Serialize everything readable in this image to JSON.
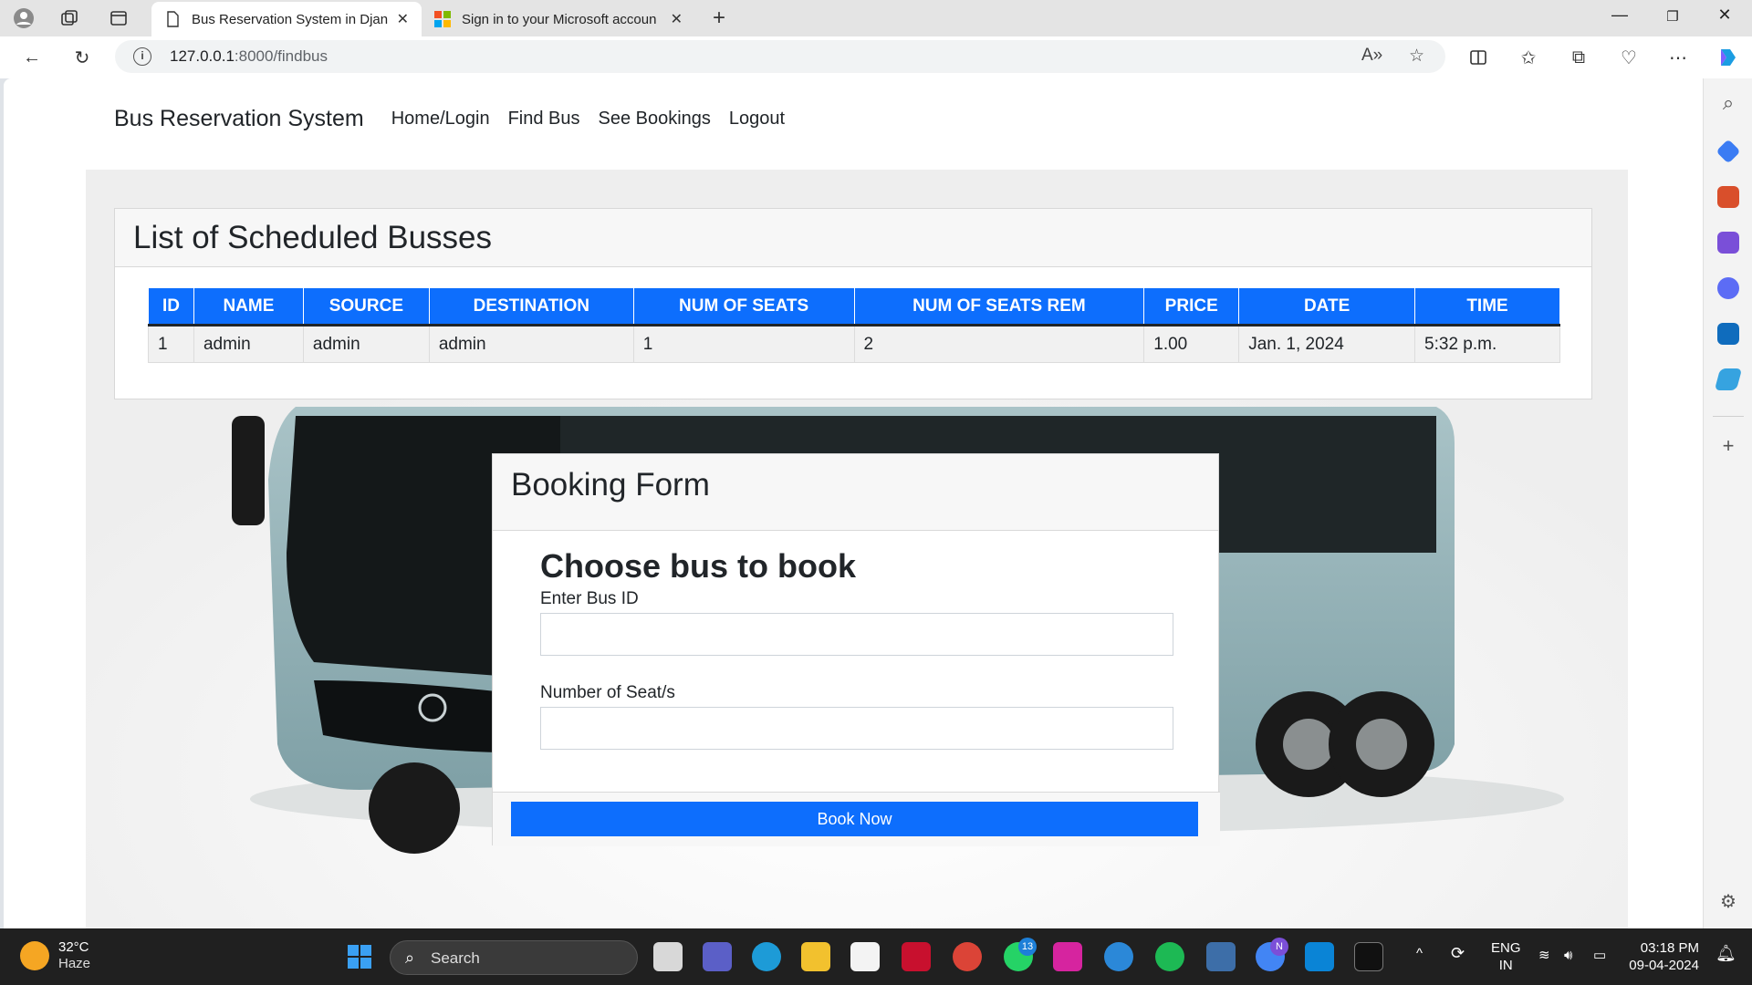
{
  "browser": {
    "tabs": [
      {
        "title": "Bus Reservation System in Djang",
        "active": true
      },
      {
        "title": "Sign in to your Microsoft accoun",
        "active": false
      }
    ],
    "address": {
      "host": "127.0.0.1",
      "path": ":8000/findbus"
    }
  },
  "site": {
    "brand": "Bus Reservation System",
    "nav": [
      "Home/Login",
      "Find Bus",
      "See Bookings",
      "Logout"
    ]
  },
  "buses": {
    "title": "List of Scheduled Busses",
    "columns": [
      "ID",
      "NAME",
      "SOURCE",
      "DESTINATION",
      "NUM OF SEATS",
      "NUM OF SEATS REM",
      "PRICE",
      "DATE",
      "TIME"
    ],
    "rows": [
      [
        "1",
        "admin",
        "admin",
        "admin",
        "1",
        "2",
        "1.00",
        "Jan. 1, 2024",
        "5:32 p.m."
      ]
    ]
  },
  "booking": {
    "title": "Booking Form",
    "subtitle": "Choose bus to book",
    "bus_id_label": "Enter Bus ID",
    "bus_id_value": "",
    "seats_label": "Number of Seat/s",
    "seats_value": "",
    "submit_label": "Book Now"
  },
  "taskbar": {
    "weather_temp": "32°C",
    "weather_desc": "Haze",
    "search_placeholder": "Search",
    "whatsapp_badge": "13",
    "chrome_badge": "N",
    "lang_top": "ENG",
    "lang_bottom": "IN",
    "time": "03:18 PM",
    "date": "09-04-2024"
  },
  "colors": {
    "primary": "#0d6efd",
    "taskbar": "#202020"
  }
}
